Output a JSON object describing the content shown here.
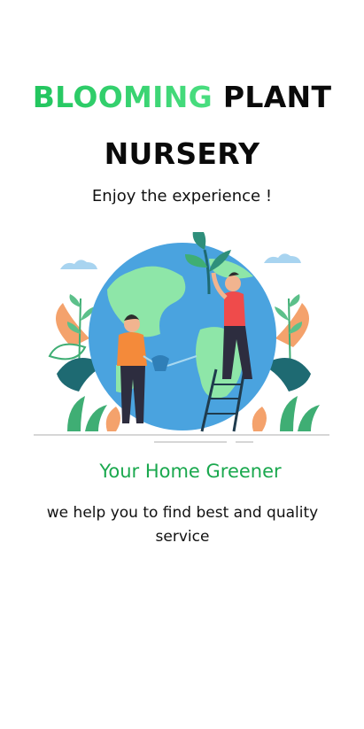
{
  "header": {
    "title_accent": "BLOOMING",
    "title_rest_line1": "PLANT",
    "title_line2": "NURSERY",
    "subtitle": "Enjoy the experience !"
  },
  "hero": {
    "illustration_icon": "globe-gardening-illustration-icon"
  },
  "content": {
    "tagline": "Your Home Greener",
    "description": "we help you to find best and quality service"
  },
  "colors": {
    "accent_green": "#1aa84e",
    "title_green": "#22c55e",
    "text": "#111111"
  }
}
